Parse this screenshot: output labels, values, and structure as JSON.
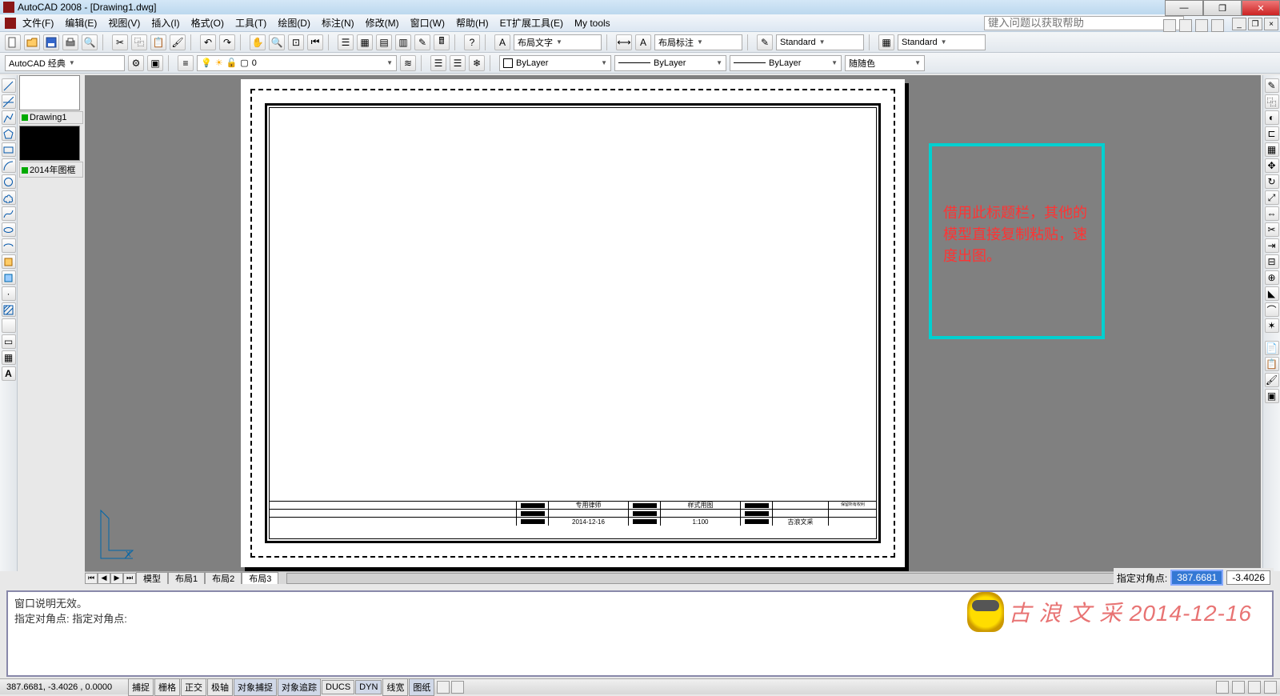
{
  "title": "AutoCAD 2008 - [Drawing1.dwg]",
  "menus": [
    "文件(F)",
    "编辑(E)",
    "视图(V)",
    "插入(I)",
    "格式(O)",
    "工具(T)",
    "绘图(D)",
    "标注(N)",
    "修改(M)",
    "窗口(W)",
    "帮助(H)",
    "ET扩展工具(E)",
    "My tools"
  ],
  "help_placeholder": "键入问题以获取帮助",
  "workspace": "AutoCAD 经典",
  "text_style_label": "布局文字",
  "dim_style_label": "布局标注",
  "text_style": "Standard",
  "dim_style": "Standard",
  "layer_display": "0",
  "prop_layer": "ByLayer",
  "prop_ltype": "ByLayer",
  "prop_lweight": "ByLayer",
  "prop_color": "随随色",
  "drawings": [
    {
      "name": "Drawing1",
      "thumb": "light"
    },
    {
      "name": "2014年图框",
      "thumb": "dark"
    }
  ],
  "annotation_text": "借用此标题栏，其他的模型直接复制粘贴，速度出图。",
  "titleblock": {
    "r1c2": "专用律师",
    "r1c4": "样式用图",
    "r2c2": "2014-12-16",
    "r2c4": "1:100",
    "r2c6": "古浪文采"
  },
  "layout_tabs": [
    "模型",
    "布局1",
    "布局2",
    "布局3"
  ],
  "active_layout": 3,
  "cmd_history": "窗口说明无效。",
  "cmd_prompt": "指定对角点: 指定对角点:",
  "coord_label": "指定对角点:",
  "coord_x": "387.6681",
  "coord_y": "-3.4026",
  "status_coords": "387.6681, -3.4026 , 0.0000",
  "status_toggles": [
    "捕捉",
    "栅格",
    "正交",
    "极轴",
    "对象捕捉",
    "对象追踪",
    "DUCS",
    "DYN",
    "线宽",
    "图纸"
  ],
  "watermark_text": "古 浪 文 采  2014-12-16"
}
